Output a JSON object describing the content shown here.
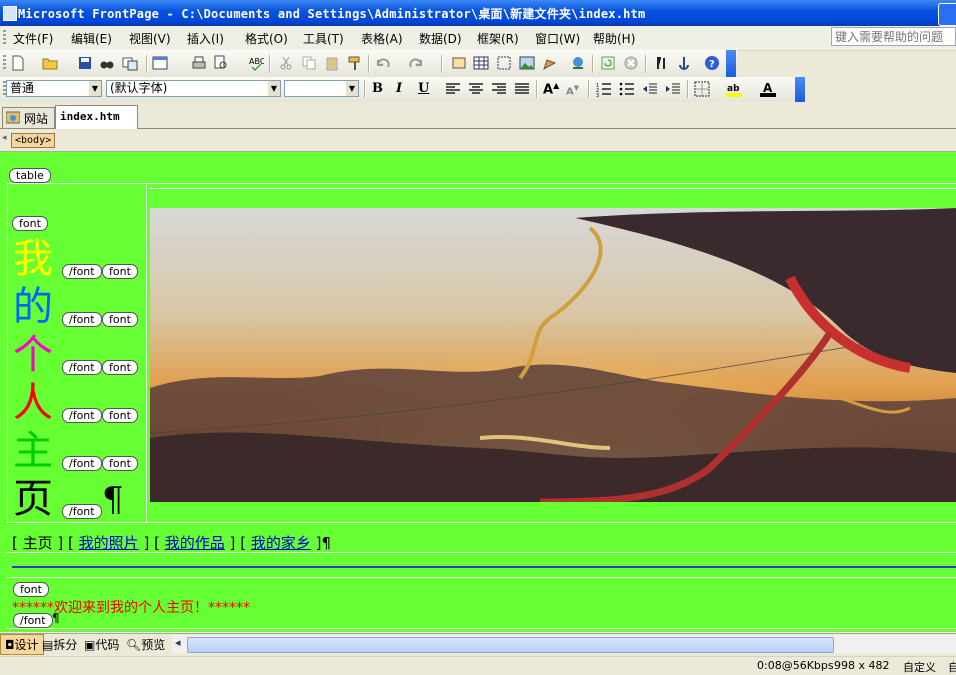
{
  "window": {
    "title": "Microsoft FrontPage - C:\\Documents and Settings\\Administrator\\桌面\\新建文件夹\\index.htm"
  },
  "menu": {
    "items": [
      "文件(F)",
      "编辑(E)",
      "视图(V)",
      "插入(I)",
      "格式(O)",
      "工具(T)",
      "表格(A)",
      "数据(D)",
      "框架(R)",
      "窗口(W)",
      "帮助(H)"
    ],
    "help_placeholder": "键入需要帮助的问题"
  },
  "format_toolbar": {
    "style": "普通",
    "font": "(默认字体)",
    "size": ""
  },
  "tabs": {
    "site": "网站",
    "doc": "index.htm"
  },
  "quicktag": "<body>",
  "design": {
    "table_tag": "table",
    "font_tag": "font",
    "font_close": "/font",
    "title_chars": [
      "我",
      "的",
      "个",
      "人",
      "主",
      "页"
    ],
    "title_colors": [
      "#ffff00",
      "#0066ff",
      "#ff00cc",
      "#ff0000",
      "#00cc00",
      "#000000"
    ],
    "pilcrow": "¶",
    "nav": {
      "home": "[ 主页 ]",
      "photos": "我的照片",
      "works": "我的作品",
      "hometown": "我的家乡",
      "open": "[",
      "close": "]",
      "tail": "]¶"
    },
    "welcome": "******欢迎来到我的个人主页！******"
  },
  "view_tabs": [
    "设计",
    "拆分",
    "代码",
    "预览"
  ],
  "status": {
    "speed": "0:08@56Kbps",
    "dims": "998 x 482",
    "mode": "自定义",
    "extra": "自"
  }
}
